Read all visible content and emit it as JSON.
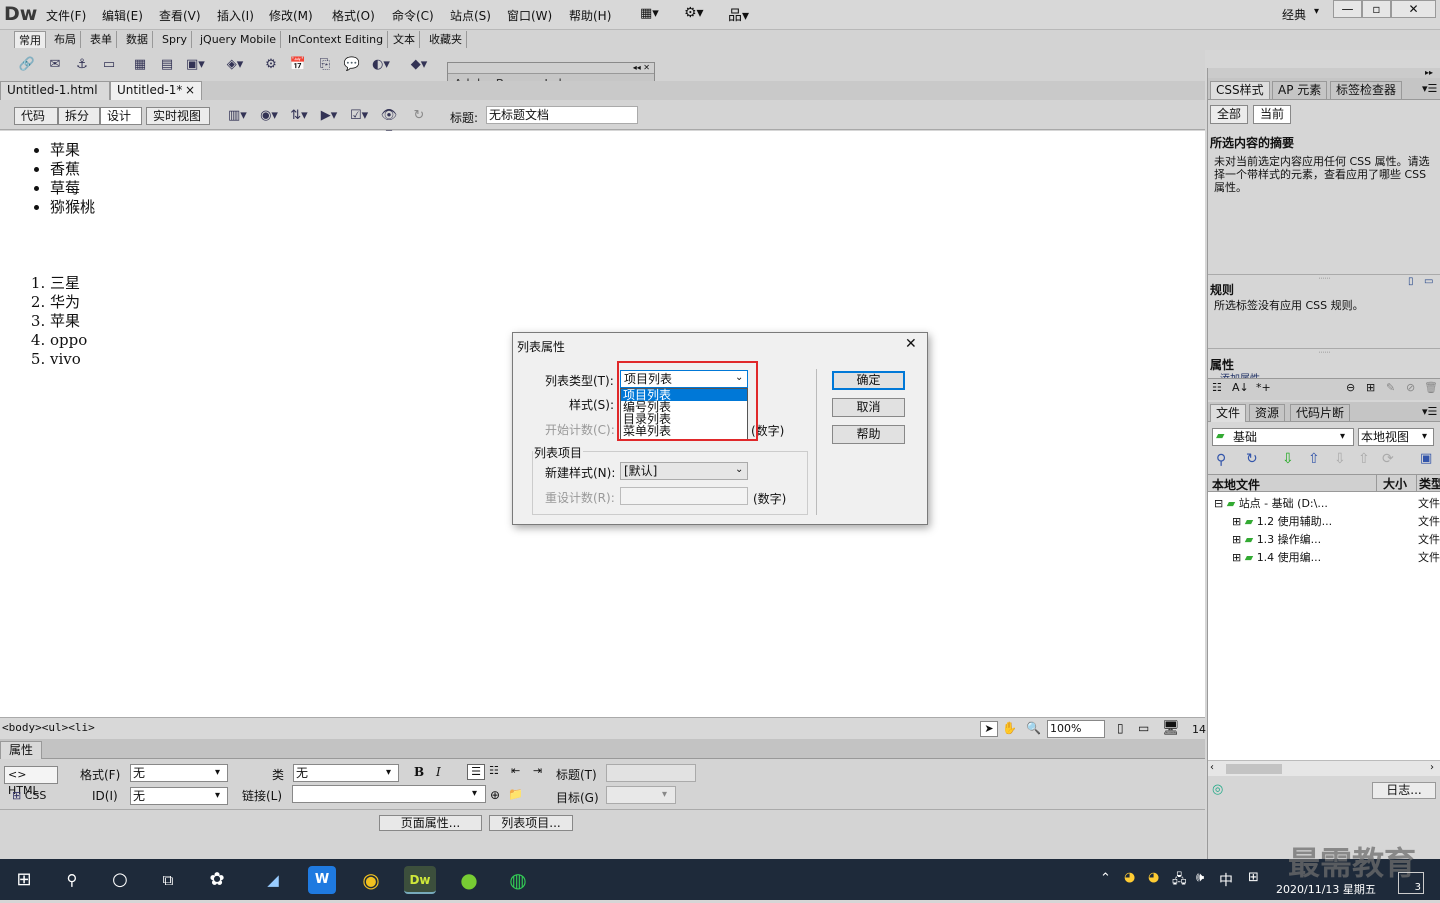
{
  "app": {
    "logo": "Dw",
    "workspace": "经典",
    "ctl_min": "—",
    "ctl_max": "▫",
    "ctl_close": "✕"
  },
  "menu": [
    "文件(F)",
    "编辑(E)",
    "查看(V)",
    "插入(I)",
    "修改(M)",
    "格式(O)",
    "命令(C)",
    "站点(S)",
    "窗口(W)",
    "帮助(H)"
  ],
  "insert_tabs": [
    "常用",
    "布局",
    "表单",
    "数据",
    "Spry",
    "jQuery Mobile",
    "InContext Editing",
    "文本",
    "收藏夹"
  ],
  "browserlab": {
    "title": "Adobe BrowserLab"
  },
  "doc_tabs": [
    {
      "label": "Untitled-1.html",
      "close": "×"
    },
    {
      "label": "Untitled-1*",
      "close": "×"
    }
  ],
  "view_buttons": [
    "代码",
    "拆分",
    "设计",
    "实时视图"
  ],
  "doc_title": {
    "label": "标题:",
    "value": "无标题文档"
  },
  "content": {
    "ul": [
      "苹果",
      "香蕉",
      "草莓",
      "猕猴桃"
    ],
    "ol": [
      "三星",
      "华为",
      "苹果",
      "oppo",
      "vivo"
    ]
  },
  "status": {
    "tags": "<body><ul><li>",
    "zoom": "100%",
    "size": "14"
  },
  "props": {
    "header": "属性",
    "html": "HTML",
    "css": "CSS",
    "format_label": "格式(F)",
    "format_value": "无",
    "id_label": "ID(I)",
    "id_value": "无",
    "class_label": "类",
    "class_value": "无",
    "link_label": "链接(L)",
    "link_value": "",
    "bold": "B",
    "italic": "I",
    "title_label": "标题(T)",
    "target_label": "目标(G)",
    "page_props": "页面属性...",
    "list_item": "列表项目..."
  },
  "right": {
    "tabs": [
      "CSS样式",
      "AP 元素",
      "标签检查器"
    ],
    "mode": [
      "全部",
      "当前"
    ],
    "summary_head": "所选内容的摘要",
    "summary_text": "未对当前选定内容应用任何 CSS 属性。请选择一个带样式的元素，查看应用了哪些 CSS 属性。",
    "rules_head": "规则",
    "rules_text": "所选标签没有应用 CSS 规则。",
    "prop_head": "属性",
    "add_prop": "添加属性",
    "file_tabs": [
      "文件",
      "资源",
      "代码片断"
    ],
    "site": "基础",
    "view": "本地视图",
    "col_local": "本地文件",
    "col_size": "大小",
    "col_type": "类型",
    "tree": [
      {
        "name": "站点 - 基础 (D:\\...",
        "type": "文件"
      },
      {
        "name": "1.2 使用辅助...",
        "type": "文件"
      },
      {
        "name": "1.3  操作编...",
        "type": "文件"
      },
      {
        "name": "1.4  使用编...",
        "type": "文件"
      }
    ],
    "log": "日志..."
  },
  "dialog": {
    "title": "列表属性",
    "close": "✕",
    "type_label": "列表类型(T):",
    "type_value": "项目列表",
    "style_label": "样式(S):",
    "start_label": "开始计数(C):",
    "digits": "(数字)",
    "options": [
      "项目列表",
      "编号列表",
      "目录列表",
      "菜单列表"
    ],
    "group": "列表项目",
    "new_style_label": "新建样式(N):",
    "new_style_value": "[默认]",
    "reset_label": "重设计数(R):",
    "reset_digits": "(数字)",
    "ok": "确定",
    "cancel": "取消",
    "help": "帮助"
  },
  "taskbar": {
    "ime": "中",
    "time": "2020/11/13 星期五",
    "watermark": "最需教育",
    "badge": "3"
  },
  "colors": {
    "highlight": "#e0282a",
    "selection": "#0078d7",
    "taskbar": "#1e2a3a"
  }
}
